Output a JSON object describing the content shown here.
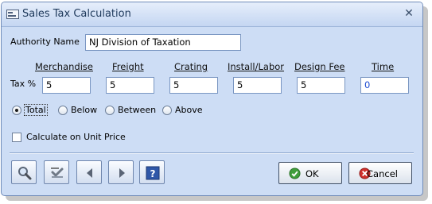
{
  "window": {
    "title": "Sales Tax Calculation"
  },
  "authority": {
    "label": "Authority Name",
    "value": "NJ Division of Taxation"
  },
  "tax": {
    "row_label": "Tax %",
    "columns": [
      {
        "label": "Merchandise",
        "value": "5"
      },
      {
        "label": "Freight",
        "value": "5"
      },
      {
        "label": "Crating",
        "value": "5"
      },
      {
        "label": "Install/Labor",
        "value": "5"
      },
      {
        "label": "Design Fee",
        "value": "5"
      },
      {
        "label": "Time",
        "value": "0"
      }
    ]
  },
  "range_options": {
    "selected": "Total",
    "items": [
      "Total",
      "Below",
      "Between",
      "Above"
    ]
  },
  "calc_unit_price": {
    "label": "Calculate on Unit Price",
    "checked": false
  },
  "toolbar": {
    "icons": [
      "search-icon",
      "spellcheck-icon",
      "previous-icon",
      "next-icon",
      "help-icon"
    ]
  },
  "buttons": {
    "ok": "OK",
    "cancel": "Cancel"
  },
  "colors": {
    "window_bg": "#cdddf5",
    "title_text": "#1e395b",
    "time_value": "#1c4bd1"
  }
}
